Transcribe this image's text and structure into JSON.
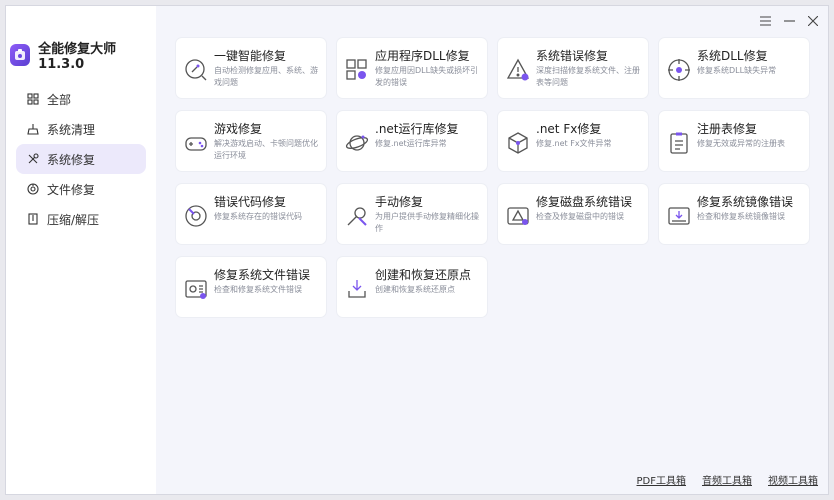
{
  "app": {
    "title": "全能修复大师 11.3.0",
    "accent": "#7a55ee"
  },
  "sidebar": {
    "items": [
      {
        "label": "全部",
        "icon": "grid-icon"
      },
      {
        "label": "系统清理",
        "icon": "broom-icon"
      },
      {
        "label": "系统修复",
        "icon": "wrench-icon",
        "active": true
      },
      {
        "label": "文件修复",
        "icon": "file-repair-icon"
      },
      {
        "label": "压缩/解压",
        "icon": "archive-icon"
      }
    ]
  },
  "cards": [
    {
      "title": "一键智能修复",
      "desc": "自动检测修复应用、系统、游戏问题",
      "icon": "magnifier-wrench-icon"
    },
    {
      "title": "应用程序DLL修复",
      "desc": "修复应用因DLL缺失或损坏引发的错误",
      "icon": "dll-grid-icon"
    },
    {
      "title": "系统错误修复",
      "desc": "深度扫描修复系统文件、注册表等问题",
      "icon": "warning-triangle-icon"
    },
    {
      "title": "系统DLL修复",
      "desc": "修复系统DLL缺失异常",
      "icon": "target-icon"
    },
    {
      "title": "游戏修复",
      "desc": "解决游戏启动、卡顿问题优化运行环境",
      "icon": "gamepad-icon"
    },
    {
      "title": ".net运行库修复",
      "desc": "修复.net运行库异常",
      "icon": "planet-icon"
    },
    {
      "title": ".net Fx修复",
      "desc": "修复.net Fx文件异常",
      "icon": "cube-icon"
    },
    {
      "title": "注册表修复",
      "desc": "修复无效或异常的注册表",
      "icon": "clipboard-icon"
    },
    {
      "title": "错误代码修复",
      "desc": "修复系统存在的错误代码",
      "icon": "disc-wrench-icon"
    },
    {
      "title": "手动修复",
      "desc": "为用户提供手动修复精细化操作",
      "icon": "tools-icon"
    },
    {
      "title": "修复磁盘系统错误",
      "desc": "检查及修复磁盘中的错误",
      "icon": "disk-warning-icon"
    },
    {
      "title": "修复系统镜像错误",
      "desc": "检查和修复系统镜像错误",
      "icon": "image-download-icon"
    },
    {
      "title": "修复系统文件错误",
      "desc": "检查和修复系统文件错误",
      "icon": "file-scan-icon"
    },
    {
      "title": "创建和恢复还原点",
      "desc": "创建和恢复系统还原点",
      "icon": "restore-icon"
    }
  ],
  "footer": {
    "links": [
      "PDF工具箱",
      "音频工具箱",
      "视频工具箱"
    ]
  }
}
